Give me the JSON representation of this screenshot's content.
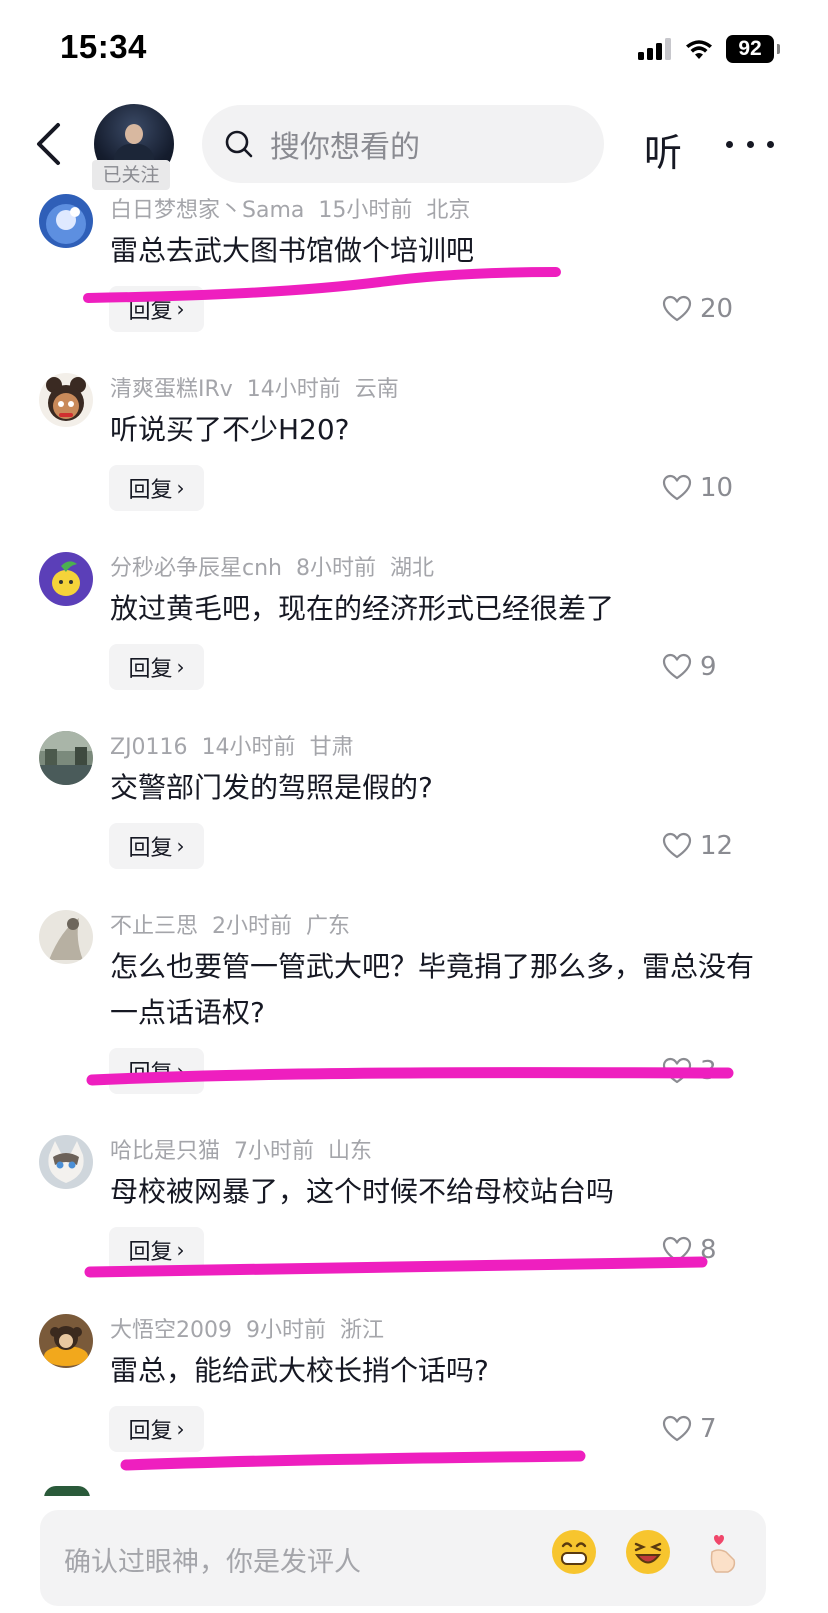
{
  "status_bar": {
    "time": "15:34",
    "battery": "92"
  },
  "header": {
    "follow_badge": "已关注",
    "search_placeholder": "搜你想看的",
    "listen_label": "听"
  },
  "comments": [
    {
      "user": "白日梦想家丶Sama",
      "time": "15小时前",
      "location": "北京",
      "text": "雷总去武大图书馆做个培训吧",
      "reply": "回复",
      "likes": "20"
    },
    {
      "user": "清爽蛋糕IRv",
      "time": "14小时前",
      "location": "云南",
      "text": "听说买了不少H20?",
      "reply": "回复",
      "likes": "10"
    },
    {
      "user": "分秒必争辰星cnh",
      "time": "8小时前",
      "location": "湖北",
      "text": "放过黄毛吧，现在的经济形式已经很差了",
      "reply": "回复",
      "likes": "9"
    },
    {
      "user": "ZJ0116",
      "time": "14小时前",
      "location": "甘肃",
      "text": "交警部门发的驾照是假的?",
      "reply": "回复",
      "likes": "12"
    },
    {
      "user": "不止三思",
      "time": "2小时前",
      "location": "广东",
      "text": "怎么也要管一管武大吧？毕竟捐了那么多，雷总没有一点话语权?",
      "reply": "回复",
      "likes": "3"
    },
    {
      "user": "哈比是只猫",
      "time": "7小时前",
      "location": "山东",
      "text": "母校被网暴了，这个时候不给母校站台吗",
      "reply": "回复",
      "likes": "8"
    },
    {
      "user": "大悟空2009",
      "time": "9小时前",
      "location": "浙江",
      "text": "雷总，能给武大校长捎个话吗?",
      "reply": "回复",
      "likes": "7"
    }
  ],
  "input": {
    "placeholder": "确认过眼神，你是发评人"
  },
  "colors": {
    "highlight": "#ee1fbf",
    "meta_text": "#a4a5aa",
    "primary_text": "#161823"
  },
  "icons": [
    "back-icon",
    "search-icon",
    "more-icon",
    "heart-icon",
    "grin-emoji-icon",
    "laugh-emoji-icon",
    "finger-heart-emoji-icon"
  ]
}
